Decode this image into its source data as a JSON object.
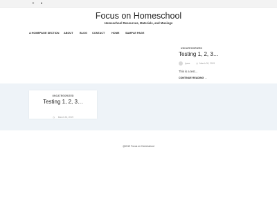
{
  "topbar": {
    "icons": [
      "menu-icon",
      "account-icon"
    ],
    "icon_glyphs": [
      "≡",
      "●"
    ]
  },
  "header": {
    "site_title": "Focus on Homeschool",
    "tagline": "Homeschool Resources, Materials, and Musings"
  },
  "nav": {
    "items": [
      {
        "label": "A Homepage Section"
      },
      {
        "label": "About"
      },
      {
        "label": "Blog"
      },
      {
        "label": "Contact"
      },
      {
        "label": "Home"
      },
      {
        "label": "Sample Page"
      }
    ]
  },
  "featured_post": {
    "category": "Uncategorized",
    "title": "Testing 1, 2, 3…",
    "author": "lyase",
    "date": "March 26, 2019",
    "excerpt": "This is a test…",
    "read_more": "Continue Reading →",
    "clock_glyph": "◷"
  },
  "card_post": {
    "category": "Uncategorized",
    "title": "Testing 1, 2, 3…",
    "date": "March 26, 2019",
    "clock_glyph": "◷"
  },
  "footer": {
    "copyright": "@2019 Focus on Homeschool"
  },
  "colors": {
    "band": "#eef3f8",
    "text": "#222222",
    "meta": "#9a9a9a"
  }
}
